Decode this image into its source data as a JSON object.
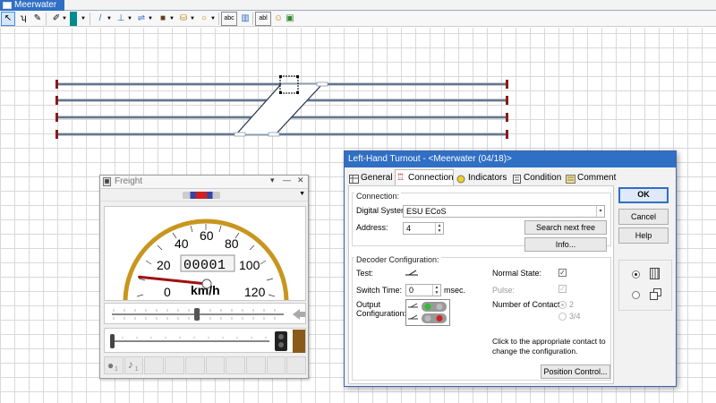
{
  "layout_tab": {
    "label": "Meerwater"
  },
  "toolbar": {
    "items": [
      {
        "name": "select-arrow-icon",
        "glyph": "↖"
      },
      {
        "name": "track-edit-icon",
        "glyph": "ʮ"
      },
      {
        "name": "pencil-icon",
        "glyph": "✎"
      },
      {
        "name": "paint-icon",
        "glyph": "✐"
      },
      {
        "name": "color-swatch-icon",
        "glyph": ""
      },
      {
        "name": "line-tool-icon",
        "glyph": "/"
      },
      {
        "name": "signal-tool-icon",
        "glyph": "⊥"
      },
      {
        "name": "switch-tool-icon",
        "glyph": "⇌"
      },
      {
        "name": "block-tool-icon",
        "glyph": "■"
      },
      {
        "name": "cylinder-icon",
        "glyph": "⛁"
      },
      {
        "name": "circle-icon",
        "glyph": "○"
      },
      {
        "name": "text-icon",
        "glyph": "abc"
      },
      {
        "name": "chart-icon",
        "glyph": "▥"
      },
      {
        "name": "face-icon",
        "glyph": "☺"
      },
      {
        "name": "image-icon",
        "glyph": "▣"
      }
    ],
    "color_swatch": "#008c8c"
  },
  "freight_window": {
    "title": "Freight",
    "speed_counter": "00001",
    "speed_unit": "km/h",
    "speed_value_kmh": 4,
    "gauge_labels": [
      "0",
      "20",
      "40",
      "60",
      "80",
      "100",
      "120"
    ],
    "function_buttons": [
      {
        "number": "1"
      },
      {
        "number": "1"
      }
    ]
  },
  "dialog": {
    "title": "Left-Hand Turnout - <Meerwater (04/18)>",
    "tabs": [
      "General",
      "Connection",
      "Indicators",
      "Condition",
      "Comment"
    ],
    "active_tab": "Connection",
    "connection_group": "Connection:",
    "digital_system_label": "Digital System:",
    "digital_system_value": "ESU ECoS",
    "address_label": "Address:",
    "address_value": "4",
    "search_button": "Search next free",
    "info_button": "Info...",
    "decoder_group": "Decoder Configuration:",
    "test_label": "Test:",
    "switch_time_label": "Switch Time:",
    "switch_time_value": "0",
    "msec_label": "msec.",
    "output_config_label_1": "Output",
    "output_config_label_2": "Configuration:",
    "normal_state_label": "Normal State:",
    "pulse_label": "Pulse:",
    "contacts_label": "Number of Contacts:",
    "contacts_option_1": "2",
    "contacts_option_2": "3/4",
    "hint_line_1": "Click to the appropriate contact to",
    "hint_line_2": "change the configuration.",
    "position_control_button": "Position Control...",
    "ok_button": "OK",
    "cancel_button": "Cancel",
    "help_button": "Help"
  },
  "colors": {
    "title_blue": "#2f6fc4",
    "track_gray": "#8a9bb0",
    "buffer_red": "#8b1a1a",
    "gauge_ring": "#c8961e",
    "needle_red": "#a01010"
  }
}
